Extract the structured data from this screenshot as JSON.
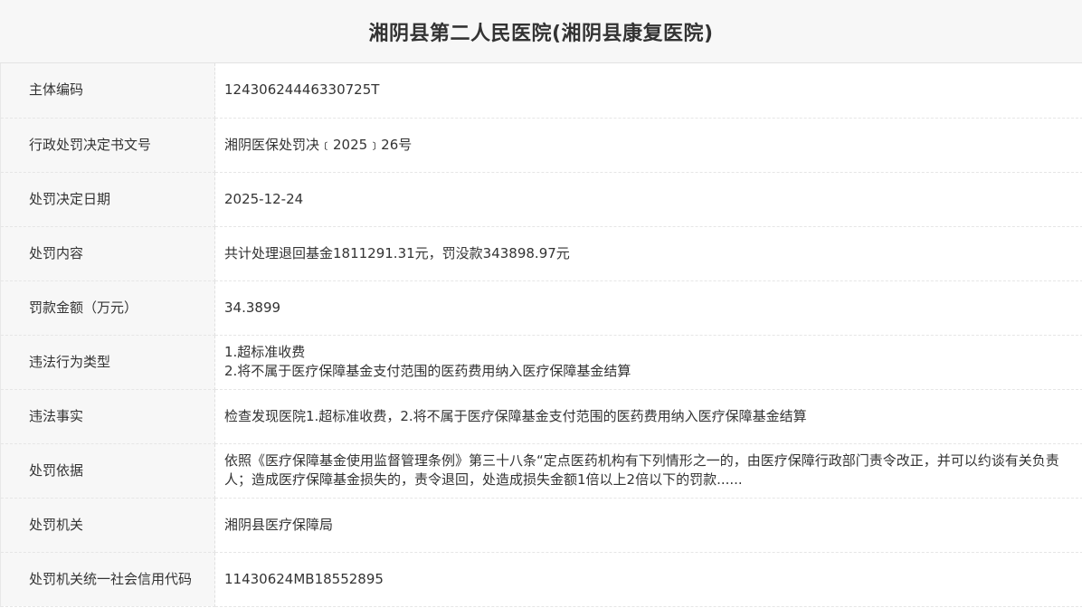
{
  "title": "湘阴县第二人民医院(湘阴县康复医院)",
  "rows": [
    {
      "label": "主体编码",
      "lines": [
        "12430624446330725T"
      ]
    },
    {
      "label": "行政处罚决定书文号",
      "lines": [
        "湘阴医保处罚决﹝2025﹞26号"
      ]
    },
    {
      "label": "处罚决定日期",
      "lines": [
        "2025-12-24"
      ]
    },
    {
      "label": "处罚内容",
      "lines": [
        "共计处理退回基金1811291.31元，罚没款343898.97元"
      ]
    },
    {
      "label": "罚款金额（万元）",
      "lines": [
        "34.3899"
      ]
    },
    {
      "label": "违法行为类型",
      "lines": [
        "1.超标准收费",
        "2.将不属于医疗保障基金支付范围的医药费用纳入医疗保障基金结算"
      ]
    },
    {
      "label": "违法事实",
      "lines": [
        "检查发现医院1.超标准收费，2.将不属于医疗保障基金支付范围的医药费用纳入医疗保障基金结算"
      ]
    },
    {
      "label": "处罚依据",
      "lines": [
        "依照《医疗保障基金使用监督管理条例》第三十八条“定点医药机构有下列情形之一的，由医疗保障行政部门责令改正，并可以约谈有关负责人；造成医疗保障基金损失的，责令退回，处造成损失金额1倍以上2倍以下的罚款......"
      ]
    },
    {
      "label": "处罚机关",
      "lines": [
        "湘阴县医疗保障局"
      ]
    },
    {
      "label": "处罚机关统一社会信用代码",
      "lines": [
        "11430624MB18552895"
      ]
    }
  ]
}
